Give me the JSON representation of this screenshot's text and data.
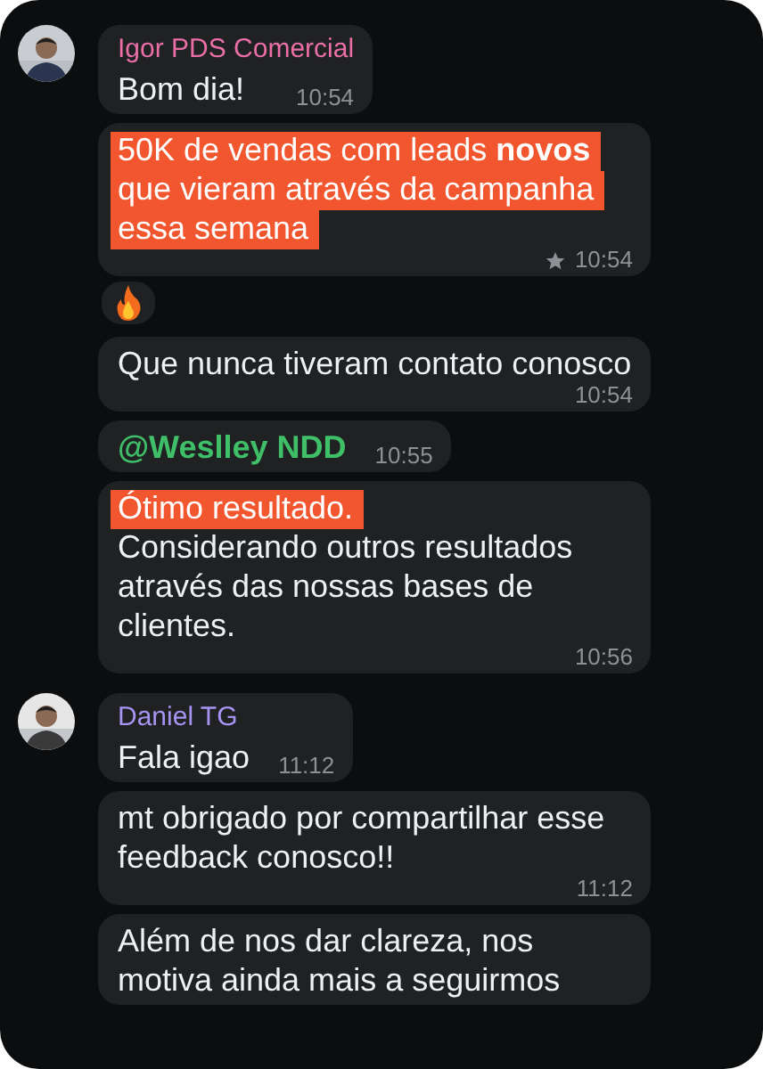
{
  "messages": [
    {
      "sender": {
        "name": "Igor PDS Comercial",
        "color": "#ea6fa6"
      },
      "paragraphs": [
        {
          "text": "Bom dia!",
          "highlighted": false
        }
      ],
      "time": "10:54",
      "starred": false
    },
    {
      "paragraphs": [
        {
          "text": "50K de vendas com leads **novos** que vieram através da campanha essa semana",
          "highlighted": true
        }
      ],
      "time": "10:54",
      "starred": true,
      "reaction": {
        "kind": "fire"
      }
    },
    {
      "paragraphs": [
        {
          "text": "Que nunca tiveram contato conosco",
          "highlighted": false
        }
      ],
      "time": "10:54",
      "starred": false
    },
    {
      "paragraphs": [
        {
          "text": "@Weslley NDD",
          "highlighted": false,
          "kind": "mention"
        }
      ],
      "time": "10:55",
      "starred": false
    },
    {
      "paragraphs": [
        {
          "text": "Ótimo resultado.",
          "highlighted": true
        },
        {
          "text": "Considerando outros resultados através das nossas bases de clientes.",
          "highlighted": false
        }
      ],
      "time": "10:56",
      "starred": false
    },
    {
      "sender": {
        "name": "Daniel TG",
        "color": "#a793f2"
      },
      "paragraphs": [
        {
          "text": "Fala igao",
          "highlighted": false
        }
      ],
      "time": "11:12",
      "starred": false
    },
    {
      "paragraphs": [
        {
          "text": "mt obrigado por compartilhar esse feedback conosco!!",
          "highlighted": false
        }
      ],
      "time": "11:12",
      "starred": false
    },
    {
      "paragraphs": [
        {
          "text": "Além de nos dar clareza, nos motiva ainda mais a seguirmos",
          "highlighted": false
        }
      ]
    }
  ]
}
